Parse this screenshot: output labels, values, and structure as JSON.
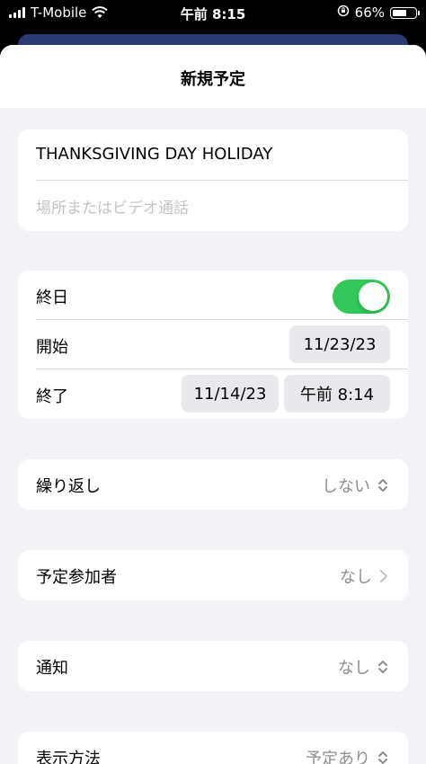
{
  "status_bar": {
    "carrier": "T-Mobile",
    "time": "午前 8:15",
    "battery": "66%",
    "battery_level": 0.66
  },
  "modal": {
    "title": "新規予定"
  },
  "event": {
    "title": "THANKSGIVING DAY HOLIDAY",
    "location_placeholder": "場所またはビデオ通話"
  },
  "date_section": {
    "all_day_label": "終日",
    "all_day_on": true,
    "start_label": "開始",
    "start_date": "11/23/23",
    "end_label": "終了",
    "end_date": "11/14/23",
    "end_time": "午前 8:14"
  },
  "repeat": {
    "label": "繰り返し",
    "value": "しない"
  },
  "invitees": {
    "label": "予定参加者",
    "value": "なし"
  },
  "alert": {
    "label": "通知",
    "value": "なし"
  },
  "show_as": {
    "label": "表示方法",
    "value": "予定あり"
  },
  "colors": {
    "toggle_on": "#34c759",
    "background_sheet": "#2a3b73",
    "secondary_text": "#8e8e93"
  }
}
